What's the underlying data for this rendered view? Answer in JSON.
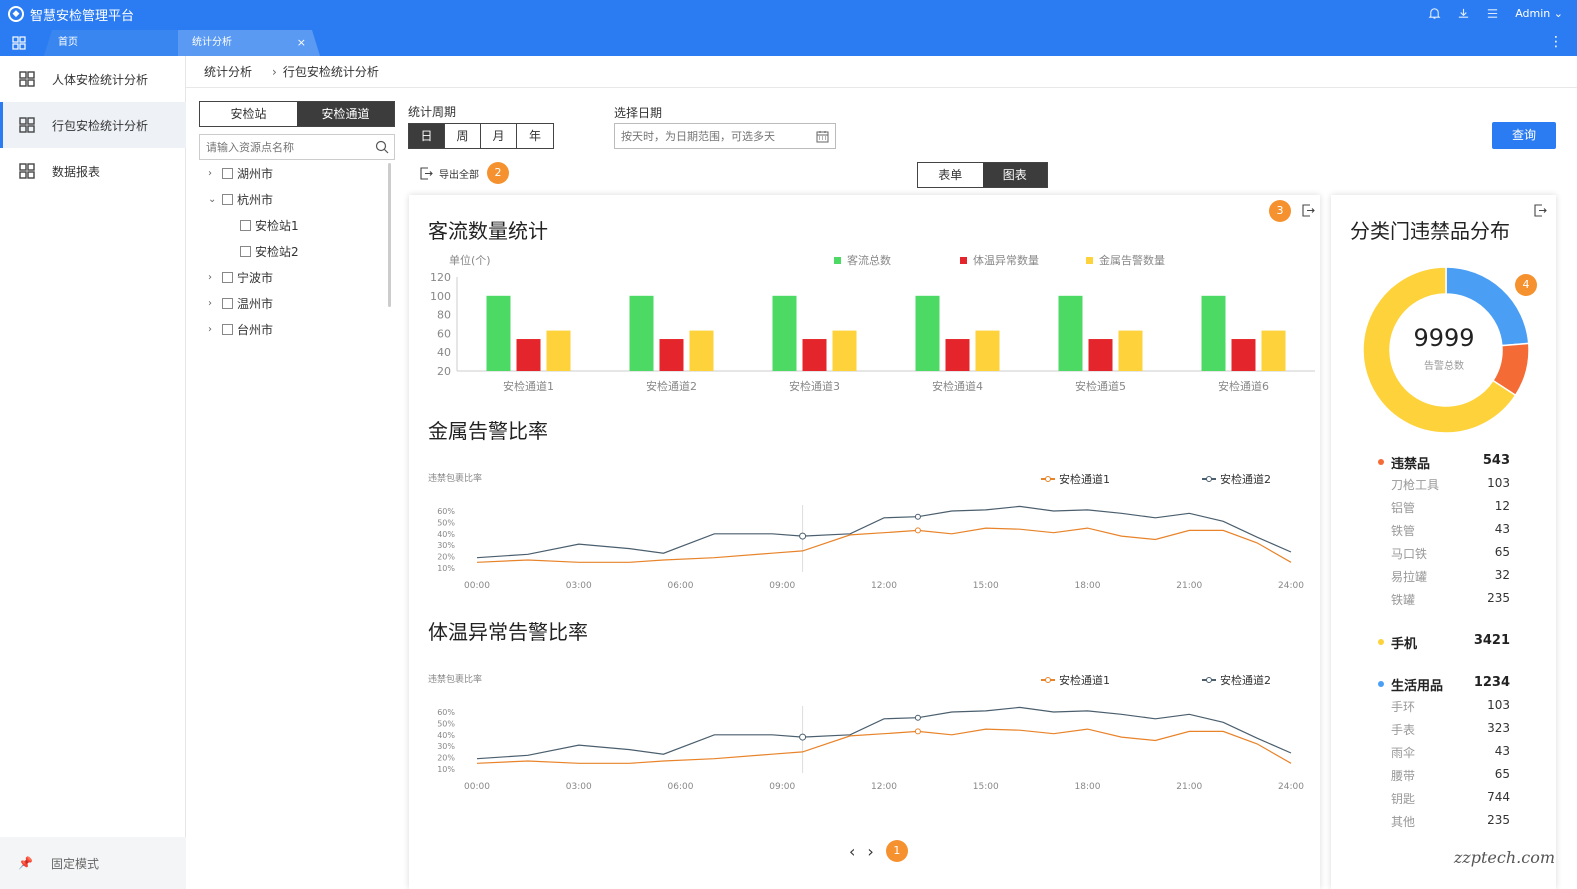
{
  "app": {
    "title": "智慧安检管理平台",
    "user": "Admin"
  },
  "tabs": [
    {
      "label": "首页"
    },
    {
      "label": "统计分析",
      "close": "×"
    }
  ],
  "sidebar": {
    "items": [
      {
        "label": "人体安检统计分析"
      },
      {
        "label": "行包安检统计分析"
      },
      {
        "label": "数据报表"
      }
    ],
    "footer": "固定模式"
  },
  "breadcrumb": {
    "root": "统计分析",
    "current": "行包安检统计分析"
  },
  "tree": {
    "segments": [
      "安检站",
      "安检通道"
    ],
    "search_placeholder": "请输入资源点名称",
    "nodes": [
      {
        "label": "湖州市",
        "arrow": "›"
      },
      {
        "label": "杭州市",
        "arrow": "⌄"
      },
      {
        "label": "安检站1"
      },
      {
        "label": "安检站2"
      },
      {
        "label": "宁波市",
        "arrow": "›"
      },
      {
        "label": "温州市",
        "arrow": "›"
      },
      {
        "label": "台州市",
        "arrow": "›"
      }
    ]
  },
  "filters": {
    "period_label": "统计周期",
    "periods": [
      "日",
      "周",
      "月",
      "年"
    ],
    "date_label": "选择日期",
    "date_placeholder": "按天时，为日期范围，可选多天",
    "query": "查询",
    "export": "导出全部",
    "views": [
      "表单",
      "图表"
    ]
  },
  "badges": [
    "1",
    "2",
    "3",
    "4"
  ],
  "charts": {
    "bar_title": "客流数量统计",
    "bar_unit": "单位(个)",
    "metal_title": "金属告警比率",
    "temp_title": "体温异常告警比率",
    "line_ylabel": "违禁包裹比率",
    "donut_title": "分类门违禁品分布",
    "donut_value": "9999",
    "donut_label": "告警总数"
  },
  "colors": {
    "primary": "#2b7cf2",
    "green": "#4cd964",
    "red": "#e4252b",
    "yellow": "#fdd23a",
    "orange": "#e8832a",
    "slate": "#4a5e6d",
    "blue": "#4a9ff5",
    "donut_orange": "#f56b35"
  },
  "chart_data": [
    {
      "type": "bar",
      "categories": [
        "安检通道1",
        "安检通道2",
        "安检通道3",
        "安检通道4",
        "安检通道5",
        "安检通道6"
      ],
      "series": [
        {
          "name": "客流总数",
          "values": [
            100,
            100,
            100,
            100,
            100,
            100
          ]
        },
        {
          "name": "体温异常数量",
          "values": [
            54,
            54,
            54,
            54,
            54,
            54
          ]
        },
        {
          "name": "金属告警数量",
          "values": [
            63,
            63,
            63,
            63,
            63,
            63
          ]
        }
      ],
      "yticks": [
        20,
        40,
        60,
        80,
        100,
        120
      ],
      "ylim": [
        20,
        120
      ],
      "legend": "top"
    },
    {
      "type": "line",
      "xticks": [
        "00:00",
        "03:00",
        "06:00",
        "09:00",
        "12:00",
        "15:00",
        "18:00",
        "21:00",
        "24:00"
      ],
      "yticks": [
        "10%",
        "20%",
        "30%",
        "40%",
        "50%",
        "60%"
      ],
      "x": [
        0,
        1.5,
        3,
        4.5,
        5.5,
        7,
        8.7,
        9.6,
        11,
        12,
        13,
        14,
        15,
        16,
        17,
        18,
        19,
        20,
        21,
        22,
        23,
        24
      ],
      "series": [
        {
          "name": "安检通道1",
          "values": [
            15,
            17,
            15,
            15,
            17,
            19,
            23,
            25,
            39,
            41,
            43,
            40,
            45,
            44,
            41,
            45,
            38,
            35,
            43,
            43,
            32,
            15
          ]
        },
        {
          "name": "安检通道2",
          "values": [
            19,
            22,
            31,
            27,
            23,
            40,
            40,
            38,
            40,
            54,
            55,
            60,
            61,
            64,
            60,
            61,
            58,
            54,
            58,
            51,
            37,
            24
          ]
        }
      ],
      "ylim": [
        10,
        60
      ]
    },
    {
      "type": "line",
      "xticks": [
        "00:00",
        "03:00",
        "06:00",
        "09:00",
        "12:00",
        "15:00",
        "18:00",
        "21:00",
        "24:00"
      ],
      "yticks": [
        "10%",
        "20%",
        "30%",
        "40%",
        "50%",
        "60%"
      ],
      "x": [
        0,
        1.5,
        3,
        4.5,
        5.5,
        7,
        8.7,
        9.6,
        11,
        12,
        13,
        14,
        15,
        16,
        17,
        18,
        19,
        20,
        21,
        22,
        23,
        24
      ],
      "series": [
        {
          "name": "安检通道1",
          "values": [
            15,
            17,
            15,
            15,
            17,
            19,
            23,
            25,
            39,
            41,
            43,
            40,
            45,
            44,
            41,
            45,
            38,
            35,
            43,
            43,
            32,
            15
          ]
        },
        {
          "name": "安检通道2",
          "values": [
            19,
            22,
            31,
            27,
            23,
            40,
            40,
            38,
            40,
            54,
            55,
            60,
            61,
            64,
            60,
            61,
            58,
            54,
            58,
            51,
            37,
            24
          ]
        }
      ],
      "ylim": [
        10,
        60
      ]
    },
    {
      "type": "pie",
      "categories": [
        "违禁品",
        "手机",
        "生活用品"
      ],
      "values": [
        543,
        3421,
        1234
      ]
    }
  ],
  "categories": [
    {
      "name": "违禁品",
      "value": "543",
      "items": [
        {
          "name": "刀枪工具",
          "value": "103"
        },
        {
          "name": "铝管",
          "value": "12"
        },
        {
          "name": "铁管",
          "value": "43"
        },
        {
          "name": "马口铁",
          "value": "65"
        },
        {
          "name": "易拉罐",
          "value": "32"
        },
        {
          "name": "铁罐",
          "value": "235"
        }
      ]
    },
    {
      "name": "手机",
      "value": "3421",
      "items": []
    },
    {
      "name": "生活用品",
      "value": "1234",
      "items": [
        {
          "name": "手环",
          "value": "103"
        },
        {
          "name": "手表",
          "value": "323"
        },
        {
          "name": "雨伞",
          "value": "43"
        },
        {
          "name": "腰带",
          "value": "65"
        },
        {
          "name": "钥匙",
          "value": "744"
        },
        {
          "name": "其他",
          "value": "235"
        }
      ]
    }
  ],
  "watermark": "zzptech.com"
}
